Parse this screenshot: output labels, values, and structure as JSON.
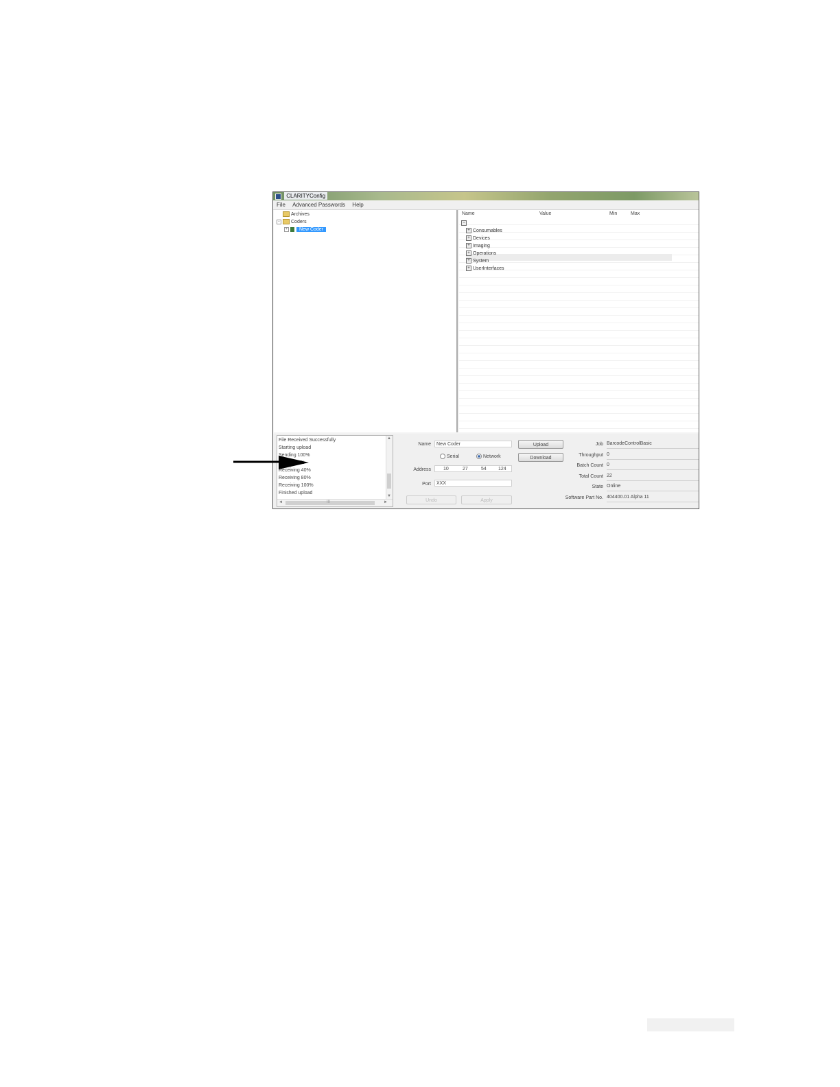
{
  "window": {
    "title": "CLARITYConfig",
    "menu": [
      "File",
      "Advanced Passwords",
      "Help"
    ]
  },
  "tree": {
    "items": [
      {
        "label": "Archives"
      },
      {
        "label": "Coders"
      },
      {
        "label": "New Coder",
        "selected": true
      }
    ]
  },
  "grid": {
    "columns": [
      "Name",
      "Value",
      "Min",
      "Max"
    ],
    "rows": [
      "Consumables",
      "Devices",
      "Imaging",
      "Operations",
      "System",
      "UserInterfaces"
    ]
  },
  "log": {
    "lines": [
      "File Received Successfully",
      "Starting upload",
      "Sending 100%",
      "Sending 1%",
      "Receiving 40%",
      "Receiving 80%",
      "Receiving 100%",
      "Finished upload"
    ],
    "scroll_left": "◄",
    "scroll_right": "►",
    "scroll_up": "▲",
    "scroll_down": "▼",
    "scroll_grip": "III"
  },
  "connection": {
    "name_label": "Name",
    "name_value": "New Coder",
    "serial_label": "Serial",
    "network_label": "Network",
    "selected_mode": "Network",
    "address_label": "Address",
    "address_octets": [
      "10",
      "27",
      "54",
      "124"
    ],
    "port_label": "Port",
    "port_value": "XXX",
    "undo_label": "Undo",
    "apply_label": "Apply",
    "upload_label": "Upload",
    "download_label": "Download"
  },
  "status": {
    "job_label": "Job",
    "job_value": "BarcodeControlBasic",
    "throughput_label": "Throughput",
    "throughput_value": "0",
    "batch_count_label": "Batch Count",
    "batch_count_value": "0",
    "total_count_label": "Total Count",
    "total_count_value": "22",
    "state_label": "State",
    "state_value": "Online",
    "software_label": "Software Part No.",
    "software_value": "404400.01 Alpha 11"
  },
  "colors": {
    "selection": "#3399ff",
    "window_border": "#555555",
    "arrow": "#000000"
  }
}
